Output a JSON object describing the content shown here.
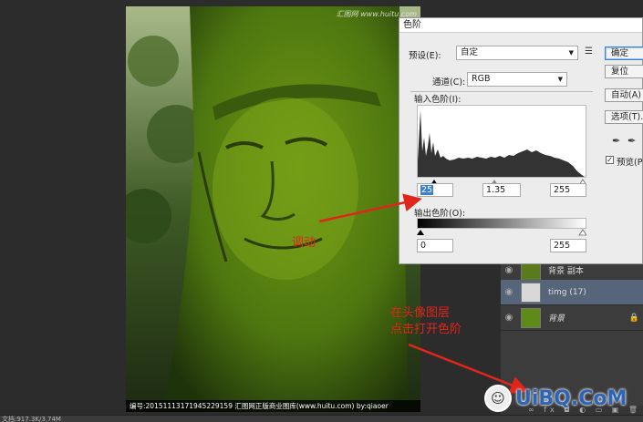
{
  "image": {
    "watermark_top": "汇图网 www.huitu.com",
    "caption": "编号:20151113171945229159   汇图网正版商业图库(www.huitu.com) by:qiaoer"
  },
  "status": {
    "zoom_text": "文档:917.3K/3.74M"
  },
  "dialog": {
    "title": "色阶",
    "preset_label": "预设(E):",
    "preset_value": "自定",
    "channel_label": "通道(C):",
    "channel_value": "RGB",
    "input_levels_label": "输入色阶(I):",
    "input_black": "25",
    "input_gamma": "1.35",
    "input_white": "255",
    "output_levels_label": "输出色阶(O):",
    "output_black": "0",
    "output_white": "255",
    "buttons": {
      "ok": "确定",
      "reset": "复位",
      "auto": "自动(A)",
      "options": "选项(T)..."
    },
    "preview_label": "预览(P)",
    "preview_checked": "✓"
  },
  "layers": [
    {
      "name": "背景 副本",
      "selected": false,
      "italic": false
    },
    {
      "name": "timg (17)",
      "selected": true,
      "italic": false
    },
    {
      "name": "背景",
      "selected": false,
      "italic": true,
      "locked": true
    }
  ],
  "layers_footer": "∞ fx ◘ ◐ ▭ ▣ 🗑",
  "annotations": {
    "adjust": "调动",
    "instruction_line1": "在头像图层",
    "instruction_line2": "点击打开色阶"
  },
  "site_watermark": {
    "logo_glyph": "☺",
    "text": "UiBQ.CoM"
  },
  "colors": {
    "annotation_red": "#e0251b",
    "selection_blue": "#3b7fd6",
    "layer_selected": "#56657a"
  },
  "icons": [
    "eye-icon",
    "lock-icon",
    "eyedropper-black-icon",
    "eyedropper-gray-icon",
    "eyedropper-white-icon",
    "preset-menu-icon"
  ]
}
